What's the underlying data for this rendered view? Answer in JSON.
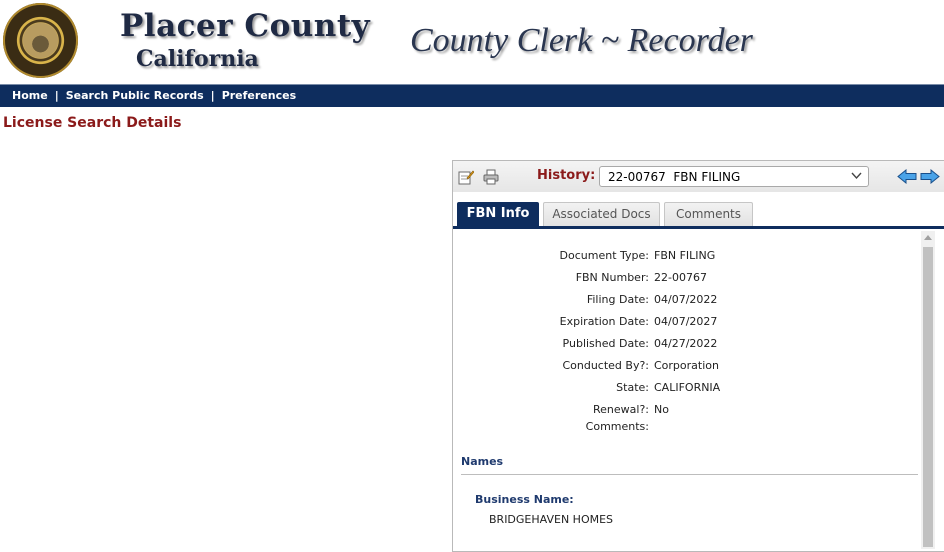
{
  "header": {
    "brand_title": "Placer County",
    "brand_subtitle": "California",
    "department_title": "County Clerk ~ Recorder"
  },
  "nav": {
    "items": [
      {
        "label": "Home"
      },
      {
        "label": "Search Public Records"
      },
      {
        "label": "Preferences"
      }
    ],
    "separator": "|"
  },
  "page": {
    "title": "License Search Details"
  },
  "panel": {
    "history_label": "History:",
    "history_selected": "22-00767  FBN FILING",
    "tabs": [
      {
        "label": "FBN Info",
        "active": true
      },
      {
        "label": "Associated Docs",
        "active": false
      },
      {
        "label": "Comments",
        "active": false
      }
    ],
    "fields": [
      {
        "label": "Document Type:",
        "value": "FBN FILING"
      },
      {
        "label": "FBN Number:",
        "value": "22-00767"
      },
      {
        "label": "Filing Date:",
        "value": "04/07/2022"
      },
      {
        "label": "Expiration Date:",
        "value": "04/07/2027"
      },
      {
        "label": "Published Date:",
        "value": "04/27/2022"
      },
      {
        "label": "Conducted By?:",
        "value": "Corporation"
      },
      {
        "label": "State:",
        "value": "CALIFORNIA"
      },
      {
        "label": "Renewal?:",
        "value": "No"
      },
      {
        "label": "Comments:",
        "value": ""
      }
    ],
    "names_section_title": "Names",
    "business_name_label": "Business Name:",
    "business_name_value": "BRIDGEHAVEN HOMES"
  },
  "icons": {
    "edit": "edit-document-icon",
    "print": "printer-icon",
    "prev": "arrow-left-icon",
    "next": "arrow-right-icon"
  },
  "colors": {
    "nav_bg": "#0e2d5e",
    "accent_red": "#8b1a1a",
    "section_blue": "#1f3a6e"
  }
}
